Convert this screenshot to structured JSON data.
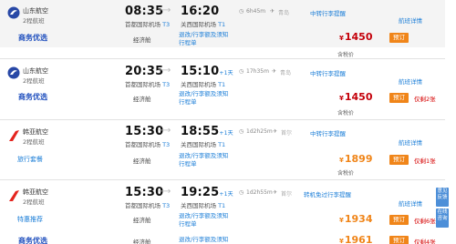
{
  "flights": [
    {
      "airline": "山东航空",
      "flight_type": "2程航班",
      "dep_time": "08:35",
      "arr_time": "16:20",
      "arr_plus": "",
      "dep_airport": "首都国际机场",
      "dep_term": "T3",
      "arr_airport": "关西国际机场",
      "arr_term": "T1",
      "duration": "6h45m",
      "via": "青岛",
      "transfer_note": "中转行李提醒",
      "detail_link": "航班详情",
      "promo": "商务优选",
      "cabin": "经济舱",
      "rules_link": "退改/行李额及须知",
      "itinerary": "行程单",
      "currency": "¥",
      "price": "1450",
      "price_color": "#c4000a",
      "book_label": "预订",
      "seats_left": "",
      "tax_label": "含税价"
    },
    {
      "airline": "山东航空",
      "flight_type": "2程航班",
      "dep_time": "20:35",
      "arr_time": "15:10",
      "arr_plus": "+1天",
      "dep_airport": "首都国际机场",
      "dep_term": "T3",
      "arr_airport": "关西国际机场",
      "arr_term": "T1",
      "duration": "17h35m",
      "via": "青岛",
      "transfer_note": "中转行李提醒",
      "detail_link": "航班详情",
      "promo": "商务优选",
      "cabin": "经济舱",
      "rules_link": "退改/行李额及须知",
      "itinerary": "行程单",
      "currency": "¥",
      "price": "1450",
      "price_color": "#c4000a",
      "book_label": "预订",
      "seats_left": "仅剩2张",
      "tax_label": "含税价"
    },
    {
      "airline": "韩亚航空",
      "flight_type": "2程航班",
      "dep_time": "15:30",
      "arr_time": "18:55",
      "arr_plus": "+1天",
      "dep_airport": "首都国际机场",
      "dep_term": "T3",
      "arr_airport": "关西国际机场",
      "arr_term": "T1",
      "duration": "1d2h25m",
      "via": "首尔",
      "transfer_note": "中转行李提醒",
      "detail_link": "航班详情",
      "promo": "旅行套餐",
      "cabin": "经济舱",
      "rules_link": "退改/行李额及须知",
      "itinerary": "行程单",
      "currency": "¥",
      "price": "1899",
      "price_color": "#f08519",
      "book_label": "预订",
      "seats_left": "仅剩1张",
      "tax_label": "含税价"
    },
    {
      "airline": "韩亚航空",
      "flight_type": "2程航班",
      "dep_time": "15:30",
      "arr_time": "19:25",
      "arr_plus": "+1天",
      "dep_airport": "首都国际机场",
      "dep_term": "T3",
      "arr_airport": "关西国际机场",
      "arr_term": "T1",
      "duration": "1d2h55m",
      "via": "首尔",
      "transfer_note": "转机免过行李提醒",
      "detail_link": "航班详情",
      "promo": "特惠推荐",
      "cabin": "经济舱",
      "rules_link": "退改/行李额及须知",
      "itinerary": "行程单",
      "currency": "¥",
      "price": "1934",
      "price_color": "#f08519",
      "book_label": "预订",
      "seats_left": "仅剩6张",
      "tax_label": "含税价"
    },
    {
      "promo": "商务优选",
      "cabin": "经济舱",
      "rules_link": "退改/行李额及须知",
      "currency": "¥",
      "price": "1961",
      "price_color": "#f08519",
      "book_label": "预订",
      "seats_left": "仅剩4张"
    }
  ],
  "side_buttons": {
    "feedback": "意见反馈",
    "contact": "在线咨询"
  },
  "colors": {
    "link": "#1a7dd7",
    "book_button": "#f08519",
    "price_red": "#c4000a",
    "price_orange": "#f08519"
  }
}
